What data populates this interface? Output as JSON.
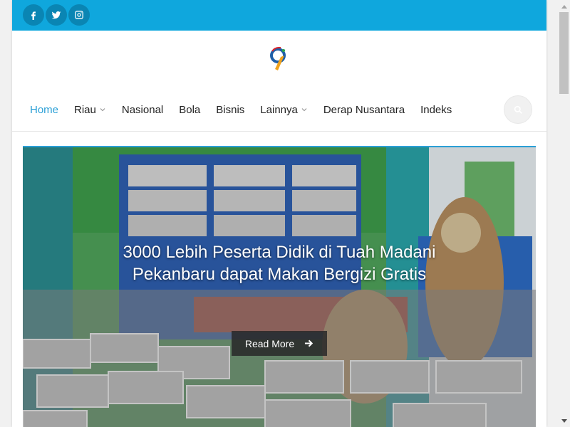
{
  "social": {
    "icons": [
      "facebook-icon",
      "twitter-icon",
      "instagram-icon"
    ]
  },
  "nav": {
    "items": [
      {
        "label": "Home",
        "active": true,
        "dropdown": false
      },
      {
        "label": "Riau",
        "active": false,
        "dropdown": true
      },
      {
        "label": "Nasional",
        "active": false,
        "dropdown": false
      },
      {
        "label": "Bola",
        "active": false,
        "dropdown": false
      },
      {
        "label": "Bisnis",
        "active": false,
        "dropdown": false
      },
      {
        "label": "Lainnya",
        "active": false,
        "dropdown": true
      },
      {
        "label": "Derap Nusantara",
        "active": false,
        "dropdown": false
      },
      {
        "label": "Indeks",
        "active": false,
        "dropdown": false
      }
    ]
  },
  "hero": {
    "title": "3000 Lebih Peserta Didik di Tuah Madani Pekanbaru dapat Makan Bergizi Gratis",
    "read_more": "Read More"
  },
  "colors": {
    "topbar": "#0fa7dd",
    "accent": "#2a9fd6"
  }
}
